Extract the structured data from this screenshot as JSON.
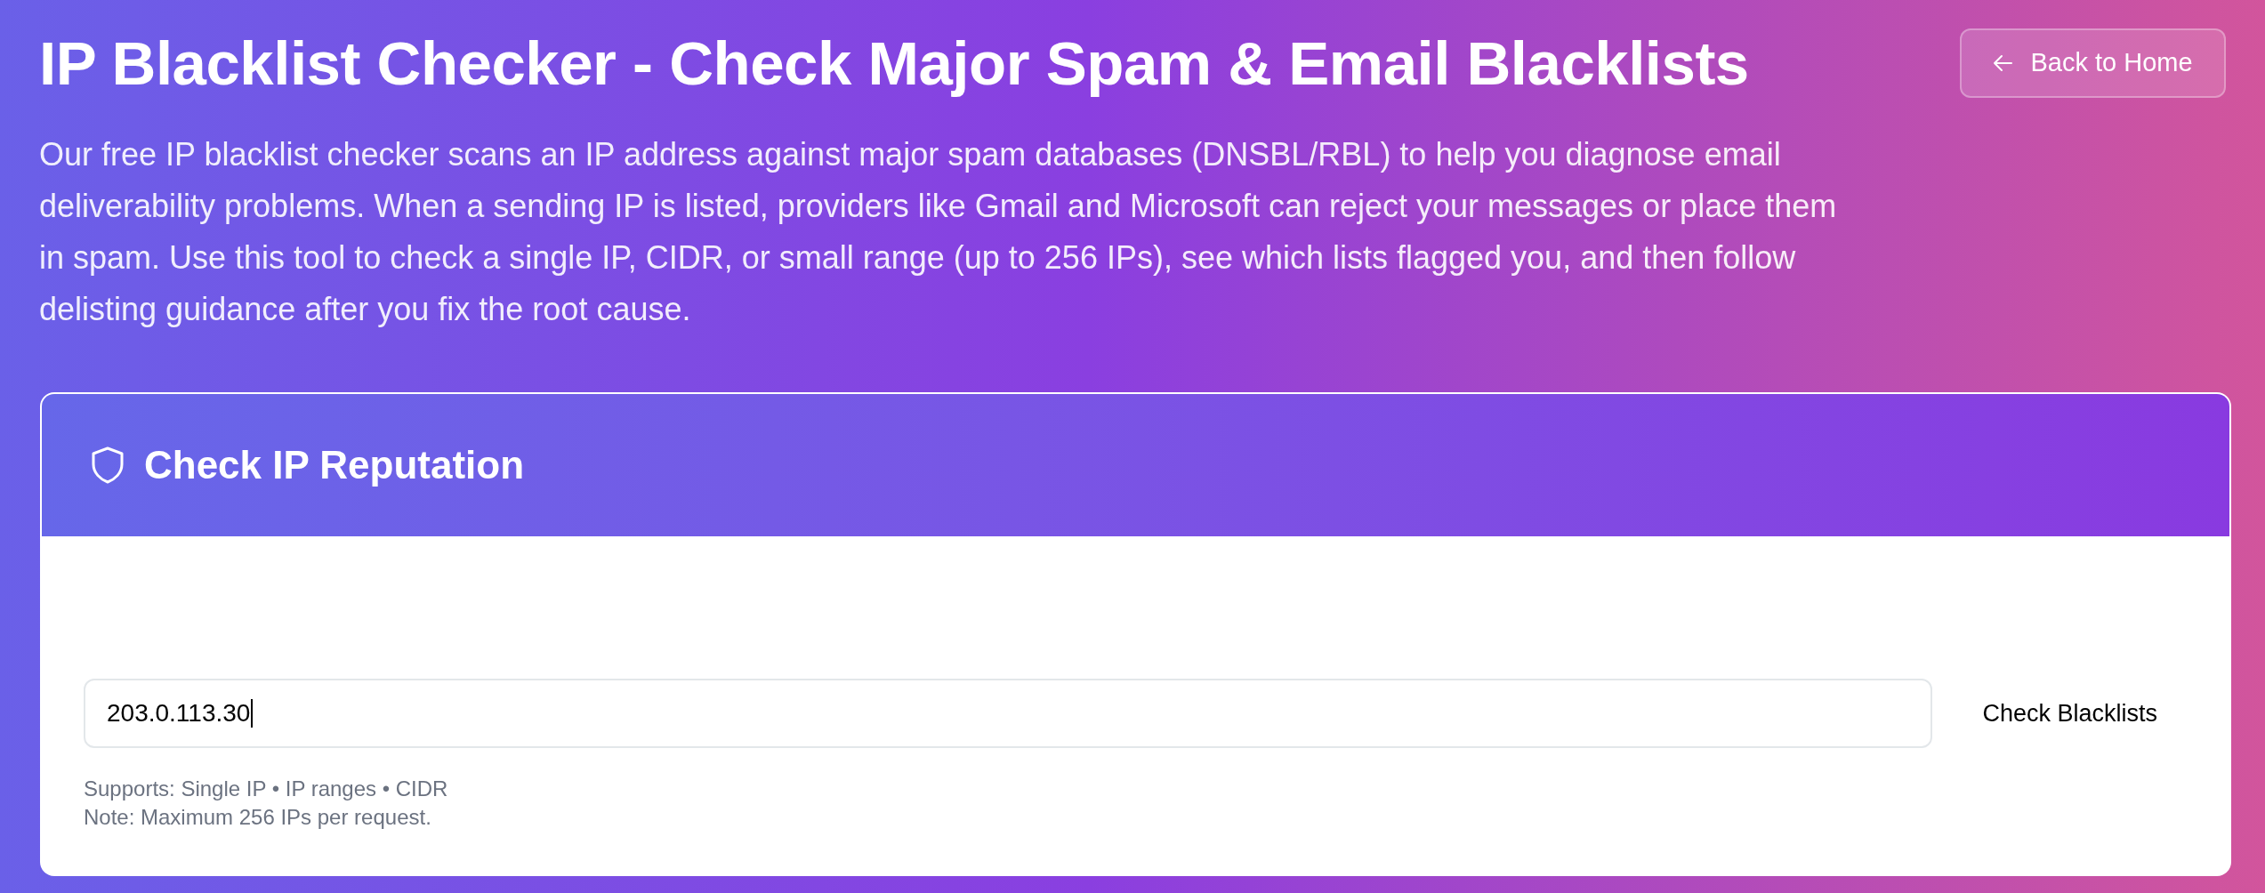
{
  "header": {
    "title": "IP Blacklist Checker - Check Major Spam & Email Blacklists",
    "description": "Our free IP blacklist checker scans an IP address against major spam databases (DNSBL/RBL) to help you diagnose email deliverability problems. When a sending IP is listed, providers like Gmail and Microsoft can reject your messages or place them in spam. Use this tool to check a single IP, CIDR, or small range (up to 256 IPs), see which lists flagged you, and then follow delisting guidance after you fix the root cause.",
    "back_button": {
      "label": "Back to Home"
    }
  },
  "card": {
    "title": "Check IP Reputation",
    "ip_input": {
      "value": "203.0.113.30",
      "focused": true
    },
    "submit_button": {
      "label": "Check Blacklists"
    },
    "help_lines": [
      "Supports: Single IP • IP ranges • CIDR",
      "Note: Maximum 256 IPs per request."
    ]
  }
}
